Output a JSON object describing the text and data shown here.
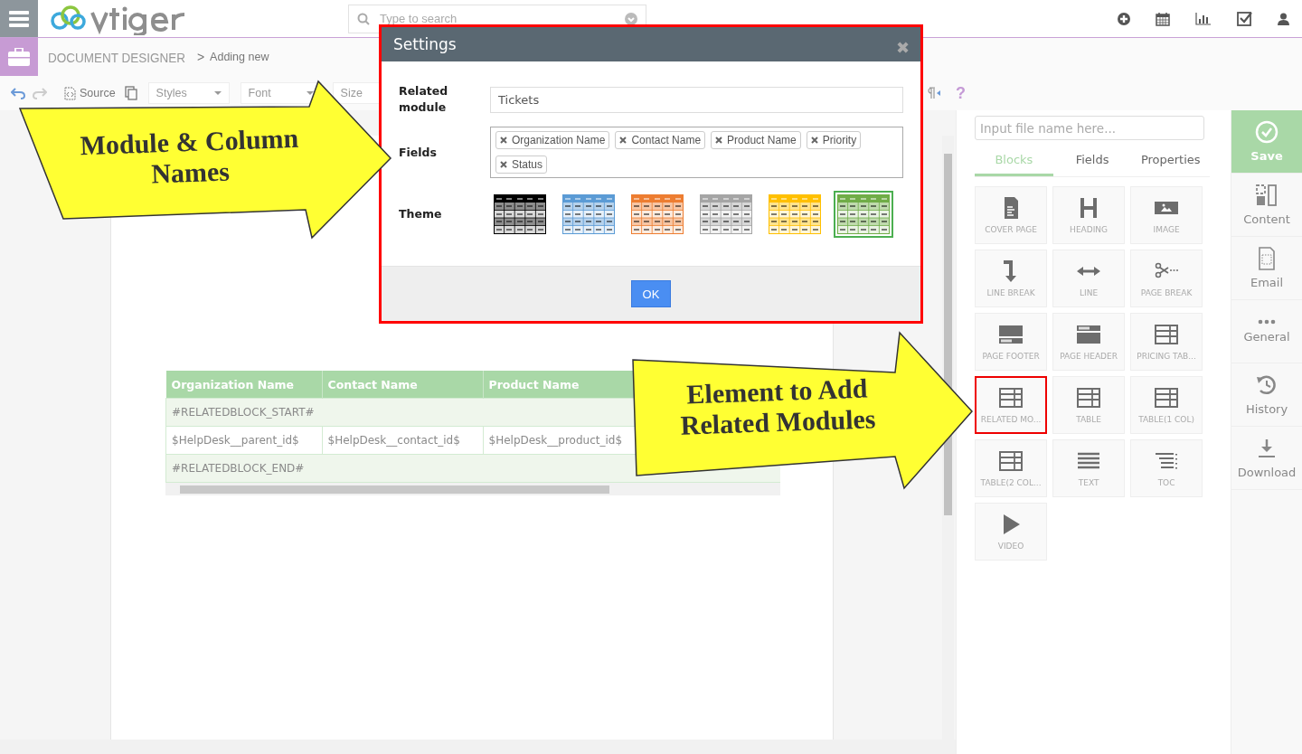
{
  "topbar": {
    "search": {
      "placeholder": "Type to search"
    }
  },
  "breadcrumb": {
    "module": "DOCUMENT DESIGNER",
    "separator": ">",
    "page": "Adding new"
  },
  "toolbar": {
    "source": "Source",
    "dropdowns": [
      "Styles",
      "Font",
      "Size"
    ],
    "help": "?"
  },
  "modal": {
    "title": "Settings",
    "close": "✖",
    "related_label": "Related module",
    "related_value": "Tickets",
    "fields_label": "Fields",
    "fields": [
      {
        "label": "Organization Name"
      },
      {
        "label": "Contact Name"
      },
      {
        "label": "Product Name"
      },
      {
        "label": "Priority"
      },
      {
        "label": "Status"
      }
    ],
    "theme_label": "Theme",
    "themes": [
      {
        "color": "#000000",
        "selected": false
      },
      {
        "color": "#5b9bd5",
        "selected": false
      },
      {
        "color": "#ed7d31",
        "selected": false
      },
      {
        "color": "#a5a5a5",
        "selected": false
      },
      {
        "color": "#ffc000",
        "selected": false
      },
      {
        "color": "#70ad47",
        "selected": true
      }
    ],
    "ok": "OK"
  },
  "table": {
    "columns": [
      "Organization Name",
      "Contact Name",
      "Product Name"
    ],
    "rows": [
      {
        "kind": "marker",
        "text": "#RELATEDBLOCK_START#"
      },
      {
        "kind": "cells",
        "cells": [
          "$HelpDesk__parent_id$",
          "$HelpDesk__contact_id$",
          "$HelpDesk__product_id$"
        ]
      },
      {
        "kind": "marker",
        "text": "#RELATEDBLOCK_END#"
      }
    ]
  },
  "panel": {
    "file_name": {
      "placeholder": "Input file name here..."
    },
    "tabs": [
      {
        "label": "Blocks",
        "selected": true
      },
      {
        "label": "Fields",
        "selected": false
      },
      {
        "label": "Properties",
        "selected": false
      }
    ],
    "blocks": [
      {
        "kind": "cover",
        "label": "COVER PAGE",
        "highlighted": false
      },
      {
        "kind": "heading",
        "label": "HEADING",
        "highlighted": false
      },
      {
        "kind": "image",
        "label": "IMAGE",
        "highlighted": false
      },
      {
        "kind": "linebreak",
        "label": "LINE BREAK",
        "highlighted": false
      },
      {
        "kind": "line",
        "label": "LINE",
        "highlighted": false
      },
      {
        "kind": "pagebreak",
        "label": "PAGE BREAK",
        "highlighted": false
      },
      {
        "kind": "footer",
        "label": "PAGE FOOTER",
        "highlighted": false
      },
      {
        "kind": "header",
        "label": "PAGE HEADER",
        "highlighted": false
      },
      {
        "kind": "table",
        "label": "PRICING TAB...",
        "highlighted": false
      },
      {
        "kind": "table",
        "label": "RELATED MO...",
        "highlighted": true
      },
      {
        "kind": "table",
        "label": "TABLE",
        "highlighted": false
      },
      {
        "kind": "table",
        "label": "TABLE(1 COL)",
        "highlighted": false
      },
      {
        "kind": "table",
        "label": "TABLE(2 COL...",
        "highlighted": false
      },
      {
        "kind": "text",
        "label": "TEXT",
        "highlighted": false
      },
      {
        "kind": "toc",
        "label": "TOC",
        "highlighted": false
      },
      {
        "kind": "video",
        "label": "VIDEO",
        "highlighted": false
      }
    ]
  },
  "nav": [
    {
      "kind": "save",
      "label": "Save"
    },
    {
      "kind": "content",
      "label": "Content"
    },
    {
      "kind": "email",
      "label": "Email"
    },
    {
      "kind": "general",
      "label": "General"
    },
    {
      "kind": "history",
      "label": "History"
    },
    {
      "kind": "download",
      "label": "Download"
    }
  ],
  "callouts": [
    {
      "text": "Module & Column Names"
    },
    {
      "text": "Element to Add Related Modules"
    }
  ]
}
